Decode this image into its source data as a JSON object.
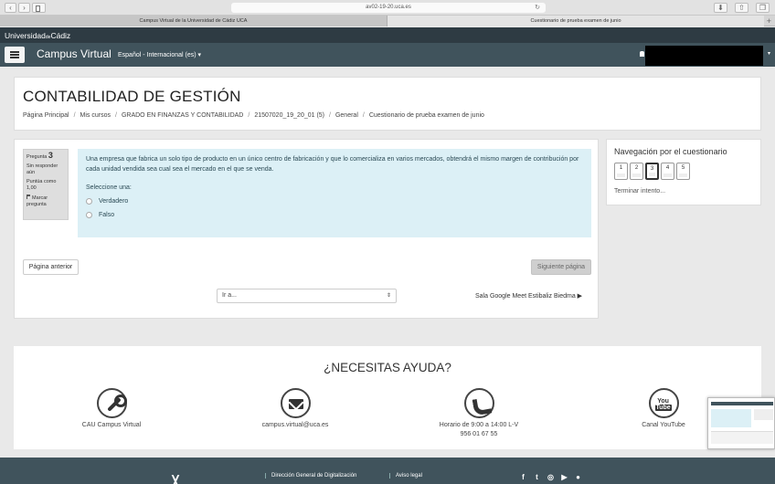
{
  "browser": {
    "url": "av02-19-20.uca.es",
    "tabs": [
      "Campus Virtual de la Universidad de Cádiz UCA",
      "Cuestionario de prueba examen de junio"
    ]
  },
  "header": {
    "uca_logo": "Universidad",
    "uca_logo_small": "de",
    "uca_logo_end": "Cádiz",
    "brand": "Campus Virtual",
    "language": "Español - Internacional (es)"
  },
  "page": {
    "title": "CONTABILIDAD DE GESTIÓN",
    "breadcrumb": [
      "Página Principal",
      "Mis cursos",
      "GRADO EN FINANZAS Y CONTABILIDAD",
      "21507020_19_20_01 (5)",
      "General",
      "Cuestionario de prueba examen de junio"
    ]
  },
  "question": {
    "label": "Pregunta",
    "number": "3",
    "status": "Sin responder aún",
    "score": "Puntúa como 1,00",
    "flag": "Marcar pregunta",
    "text": "Una empresa que fabrica un solo tipo de producto en un único centro de fabricación y que lo comercializa en varios mercados, obtendrá el mismo margen de contribución por cada unidad vendida sea cual sea el mercado en el que se venda.",
    "prompt": "Seleccione una:",
    "options": [
      "Verdadero",
      "Falso"
    ]
  },
  "controls": {
    "prev": "Página anterior",
    "next": "Siguiente página",
    "jump": "Ir a...",
    "meet": "Sala Google Meet Estibaliz Biedma ▶"
  },
  "quiz_nav": {
    "title": "Navegación por el cuestionario",
    "pages": [
      "1",
      "2",
      "3",
      "4",
      "5"
    ],
    "finish": "Terminar intento..."
  },
  "help": {
    "title": "¿NECESITAS AYUDA?",
    "cau": "CAU Campus Virtual",
    "email": "campus.virtual@uca.es",
    "hours": "Horario de 9:00 a 14:00 L-V",
    "phone": "956 01 67 55",
    "youtube": "Canal YouTube",
    "yt_you": "You",
    "yt_tube": "Tube"
  },
  "footer": {
    "link1": "Dirección General de Digitalización",
    "link2": "Aviso legal"
  }
}
